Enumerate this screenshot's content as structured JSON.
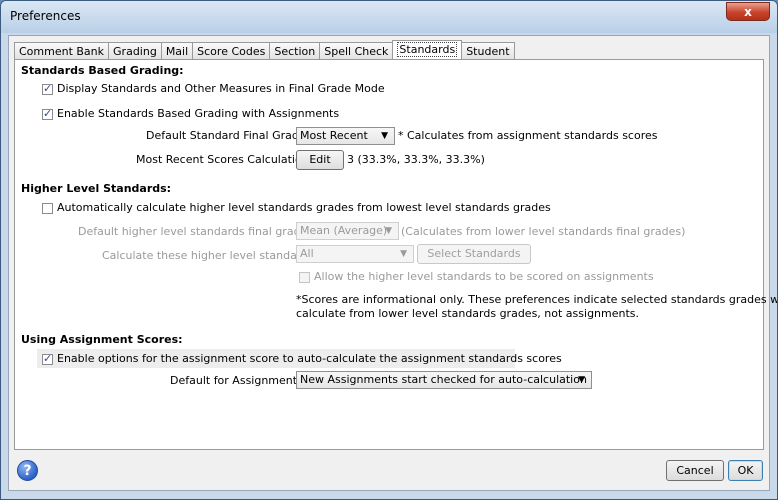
{
  "window": {
    "title": "Preferences",
    "close_glyph": "x"
  },
  "tabs": [
    {
      "label": "Comment Bank"
    },
    {
      "label": "Grading"
    },
    {
      "label": "Mail"
    },
    {
      "label": "Score Codes"
    },
    {
      "label": "Section"
    },
    {
      "label": "Spell Check"
    },
    {
      "label": "Standards",
      "active": true
    },
    {
      "label": "Student"
    }
  ],
  "sbg": {
    "title": "Standards Based Grading:",
    "display_label": "Display Standards and Other Measures in Final Grade Mode",
    "display_checked": true,
    "enable_label": "Enable Standards Based Grading with Assignments",
    "enable_checked": true,
    "final_grade_label": "Default Standard Final Grade*:",
    "final_grade_value": "Most Recent",
    "final_grade_note": "* Calculates from assignment standards scores",
    "recent_calc_label": "Most Recent Scores Calculation:",
    "edit_label": "Edit",
    "recent_calc_value": "3 (33.3%, 33.3%, 33.3%)"
  },
  "hls": {
    "title": "Higher Level Standards:",
    "auto_label": "Automatically calculate higher level standards grades from lowest level standards grades",
    "auto_checked": false,
    "default_label": "Default higher level standards final grade*:",
    "default_value": "Mean (Average)",
    "default_note": "(Calculates from lower level standards final grades)",
    "calc_label": "Calculate these higher level standards:",
    "calc_value": "All",
    "select_standards_label": "Select Standards",
    "allow_label": "Allow the higher level standards to be scored on assignments",
    "allow_checked": false,
    "note_line1": "*Scores are informational only. These preferences indicate selected standards grades will",
    "note_line2": "calculate from lower level standards grades, not assignments."
  },
  "uas": {
    "title": "Using Assignment Scores:",
    "enable_label": "Enable options for the assignment score to auto-calculate the assignment standards scores",
    "enable_checked": true,
    "default_label": "Default for Assignments:",
    "default_value": "New Assignments start checked for auto-calculation"
  },
  "footer": {
    "help_glyph": "?",
    "cancel_label": "Cancel",
    "ok_label": "OK"
  }
}
